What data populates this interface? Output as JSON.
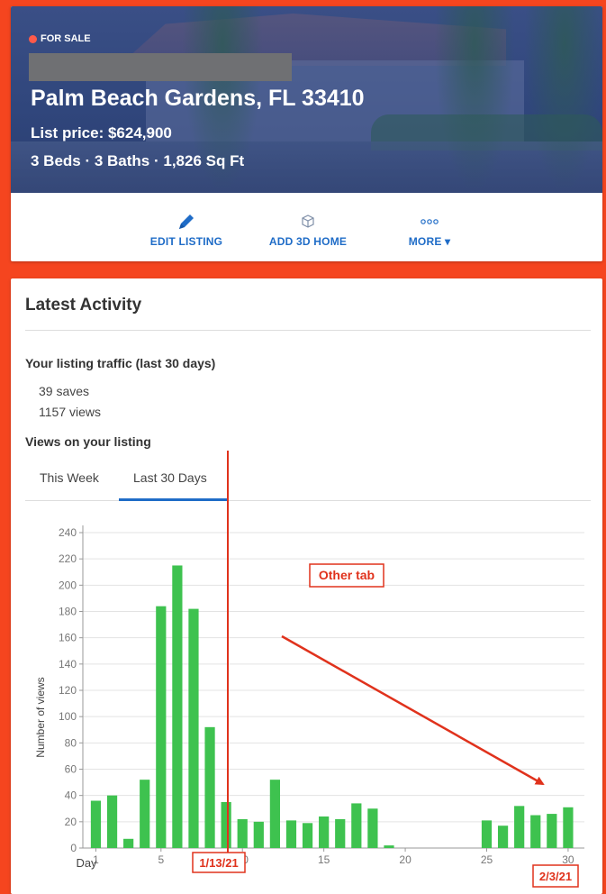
{
  "listing": {
    "status": "FOR SALE",
    "address_line2": "Palm Beach Gardens, FL 33410",
    "price": "List price: $624,900",
    "specs": "3 Beds · 3 Baths · 1,826 Sq Ft"
  },
  "actions": {
    "edit": {
      "label": "EDIT LISTING",
      "icon": "pencil-icon"
    },
    "add3d": {
      "label": "ADD 3D HOME",
      "icon": "cube-icon"
    },
    "more": {
      "label": "MORE ▾",
      "icon": "ellipsis-icon"
    }
  },
  "activity": {
    "title": "Latest Activity",
    "traffic_title": "Your listing traffic (last 30 days)",
    "saves": "39 saves",
    "views": "1157 views",
    "views_title": "Views on your listing",
    "tabs": [
      {
        "label": "This Week",
        "active": false
      },
      {
        "label": "Last 30 Days",
        "active": true
      }
    ]
  },
  "colors": {
    "background": "#f5451f",
    "accent": "#1f6cc7",
    "bar": "#3ec24f",
    "annotation": "#e0321c",
    "status_dot": "#ff5a4a"
  },
  "chart_data": {
    "type": "bar",
    "x": [
      1,
      2,
      3,
      4,
      5,
      6,
      7,
      8,
      9,
      10,
      11,
      12,
      13,
      14,
      15,
      16,
      17,
      18,
      19,
      20,
      21,
      22,
      23,
      24,
      25,
      26,
      27,
      28,
      29,
      30
    ],
    "values": [
      36,
      40,
      7,
      52,
      184,
      215,
      182,
      92,
      35,
      22,
      20,
      52,
      21,
      19,
      24,
      22,
      34,
      30,
      2,
      0,
      0,
      0,
      0,
      0,
      21,
      17,
      32,
      25,
      26,
      31
    ],
    "xlabel": "Day",
    "ylabel": "Number of views",
    "ylim": [
      0,
      240
    ],
    "yticks": [
      0,
      20,
      40,
      60,
      80,
      100,
      120,
      140,
      160,
      180,
      200,
      220,
      240
    ],
    "xticks": [
      1,
      5,
      10,
      15,
      20,
      25,
      30
    ],
    "grid": true,
    "annotations": {
      "other_tab": "Other tab",
      "start_date": "1/13/21",
      "end_date": "2/3/21"
    }
  }
}
